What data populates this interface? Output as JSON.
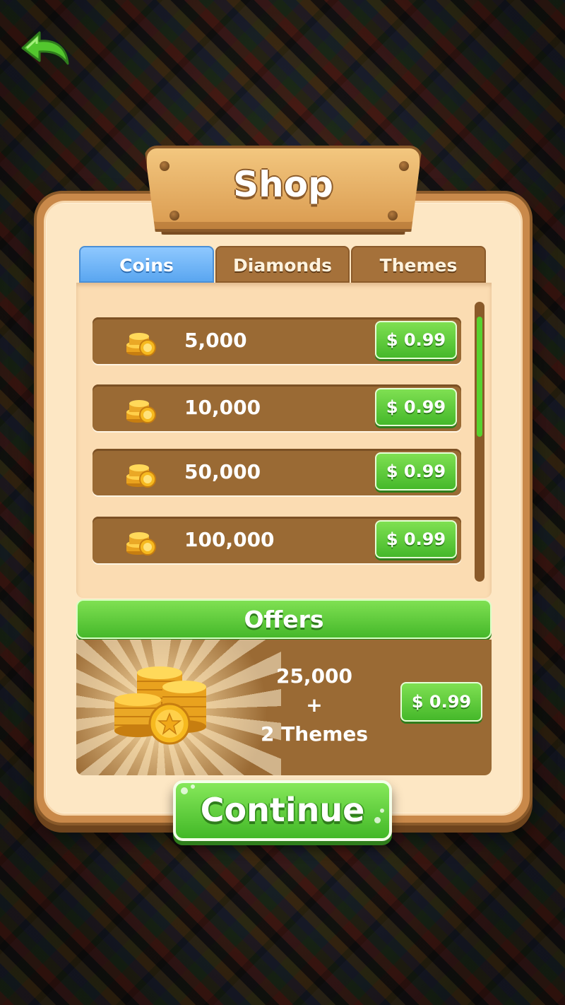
{
  "title": "Shop",
  "tabs": [
    {
      "label": "Coins",
      "selected": true
    },
    {
      "label": "Diamonds",
      "selected": false
    },
    {
      "label": "Themes",
      "selected": false
    }
  ],
  "coin_packs": [
    {
      "amount": "5,000",
      "price": "$ 0.99",
      "icon": "coin-stack-icon"
    },
    {
      "amount": "10,000",
      "price": "$ 0.99",
      "icon": "coin-stack-icon"
    },
    {
      "amount": "50,000",
      "price": "$ 0.99",
      "icon": "coin-stack-icon"
    },
    {
      "amount": "100,000",
      "price": "$ 0.99",
      "icon": "coin-stack-icon"
    }
  ],
  "offers": {
    "heading": "Offers",
    "line1": "25,000",
    "line2": "+",
    "line3": "2 Themes",
    "price": "$ 0.99"
  },
  "continue_label": "Continue",
  "icons": {
    "back": "back-arrow-icon"
  },
  "colors": {
    "accent_green": "#45b82a",
    "tab_selected_blue": "#5aa6f0",
    "wood_brown": "#9a6a34",
    "panel_cream": "#fde7c4"
  }
}
